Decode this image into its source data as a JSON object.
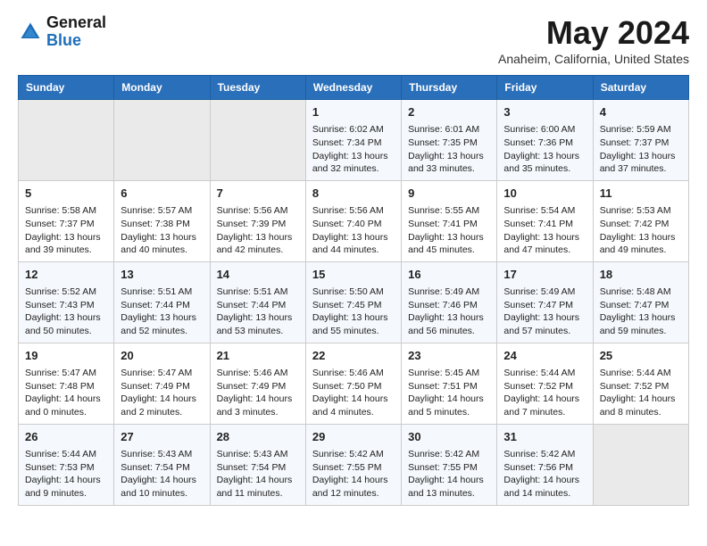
{
  "header": {
    "logo_general": "General",
    "logo_blue": "Blue",
    "title": "May 2024",
    "subtitle": "Anaheim, California, United States"
  },
  "days_of_week": [
    "Sunday",
    "Monday",
    "Tuesday",
    "Wednesday",
    "Thursday",
    "Friday",
    "Saturday"
  ],
  "weeks": [
    [
      {
        "day": "",
        "info": ""
      },
      {
        "day": "",
        "info": ""
      },
      {
        "day": "",
        "info": ""
      },
      {
        "day": "1",
        "info": "Sunrise: 6:02 AM\nSunset: 7:34 PM\nDaylight: 13 hours\nand 32 minutes."
      },
      {
        "day": "2",
        "info": "Sunrise: 6:01 AM\nSunset: 7:35 PM\nDaylight: 13 hours\nand 33 minutes."
      },
      {
        "day": "3",
        "info": "Sunrise: 6:00 AM\nSunset: 7:36 PM\nDaylight: 13 hours\nand 35 minutes."
      },
      {
        "day": "4",
        "info": "Sunrise: 5:59 AM\nSunset: 7:37 PM\nDaylight: 13 hours\nand 37 minutes."
      }
    ],
    [
      {
        "day": "5",
        "info": "Sunrise: 5:58 AM\nSunset: 7:37 PM\nDaylight: 13 hours\nand 39 minutes."
      },
      {
        "day": "6",
        "info": "Sunrise: 5:57 AM\nSunset: 7:38 PM\nDaylight: 13 hours\nand 40 minutes."
      },
      {
        "day": "7",
        "info": "Sunrise: 5:56 AM\nSunset: 7:39 PM\nDaylight: 13 hours\nand 42 minutes."
      },
      {
        "day": "8",
        "info": "Sunrise: 5:56 AM\nSunset: 7:40 PM\nDaylight: 13 hours\nand 44 minutes."
      },
      {
        "day": "9",
        "info": "Sunrise: 5:55 AM\nSunset: 7:41 PM\nDaylight: 13 hours\nand 45 minutes."
      },
      {
        "day": "10",
        "info": "Sunrise: 5:54 AM\nSunset: 7:41 PM\nDaylight: 13 hours\nand 47 minutes."
      },
      {
        "day": "11",
        "info": "Sunrise: 5:53 AM\nSunset: 7:42 PM\nDaylight: 13 hours\nand 49 minutes."
      }
    ],
    [
      {
        "day": "12",
        "info": "Sunrise: 5:52 AM\nSunset: 7:43 PM\nDaylight: 13 hours\nand 50 minutes."
      },
      {
        "day": "13",
        "info": "Sunrise: 5:51 AM\nSunset: 7:44 PM\nDaylight: 13 hours\nand 52 minutes."
      },
      {
        "day": "14",
        "info": "Sunrise: 5:51 AM\nSunset: 7:44 PM\nDaylight: 13 hours\nand 53 minutes."
      },
      {
        "day": "15",
        "info": "Sunrise: 5:50 AM\nSunset: 7:45 PM\nDaylight: 13 hours\nand 55 minutes."
      },
      {
        "day": "16",
        "info": "Sunrise: 5:49 AM\nSunset: 7:46 PM\nDaylight: 13 hours\nand 56 minutes."
      },
      {
        "day": "17",
        "info": "Sunrise: 5:49 AM\nSunset: 7:47 PM\nDaylight: 13 hours\nand 57 minutes."
      },
      {
        "day": "18",
        "info": "Sunrise: 5:48 AM\nSunset: 7:47 PM\nDaylight: 13 hours\nand 59 minutes."
      }
    ],
    [
      {
        "day": "19",
        "info": "Sunrise: 5:47 AM\nSunset: 7:48 PM\nDaylight: 14 hours\nand 0 minutes."
      },
      {
        "day": "20",
        "info": "Sunrise: 5:47 AM\nSunset: 7:49 PM\nDaylight: 14 hours\nand 2 minutes."
      },
      {
        "day": "21",
        "info": "Sunrise: 5:46 AM\nSunset: 7:49 PM\nDaylight: 14 hours\nand 3 minutes."
      },
      {
        "day": "22",
        "info": "Sunrise: 5:46 AM\nSunset: 7:50 PM\nDaylight: 14 hours\nand 4 minutes."
      },
      {
        "day": "23",
        "info": "Sunrise: 5:45 AM\nSunset: 7:51 PM\nDaylight: 14 hours\nand 5 minutes."
      },
      {
        "day": "24",
        "info": "Sunrise: 5:44 AM\nSunset: 7:52 PM\nDaylight: 14 hours\nand 7 minutes."
      },
      {
        "day": "25",
        "info": "Sunrise: 5:44 AM\nSunset: 7:52 PM\nDaylight: 14 hours\nand 8 minutes."
      }
    ],
    [
      {
        "day": "26",
        "info": "Sunrise: 5:44 AM\nSunset: 7:53 PM\nDaylight: 14 hours\nand 9 minutes."
      },
      {
        "day": "27",
        "info": "Sunrise: 5:43 AM\nSunset: 7:54 PM\nDaylight: 14 hours\nand 10 minutes."
      },
      {
        "day": "28",
        "info": "Sunrise: 5:43 AM\nSunset: 7:54 PM\nDaylight: 14 hours\nand 11 minutes."
      },
      {
        "day": "29",
        "info": "Sunrise: 5:42 AM\nSunset: 7:55 PM\nDaylight: 14 hours\nand 12 minutes."
      },
      {
        "day": "30",
        "info": "Sunrise: 5:42 AM\nSunset: 7:55 PM\nDaylight: 14 hours\nand 13 minutes."
      },
      {
        "day": "31",
        "info": "Sunrise: 5:42 AM\nSunset: 7:56 PM\nDaylight: 14 hours\nand 14 minutes."
      },
      {
        "day": "",
        "info": ""
      }
    ]
  ]
}
